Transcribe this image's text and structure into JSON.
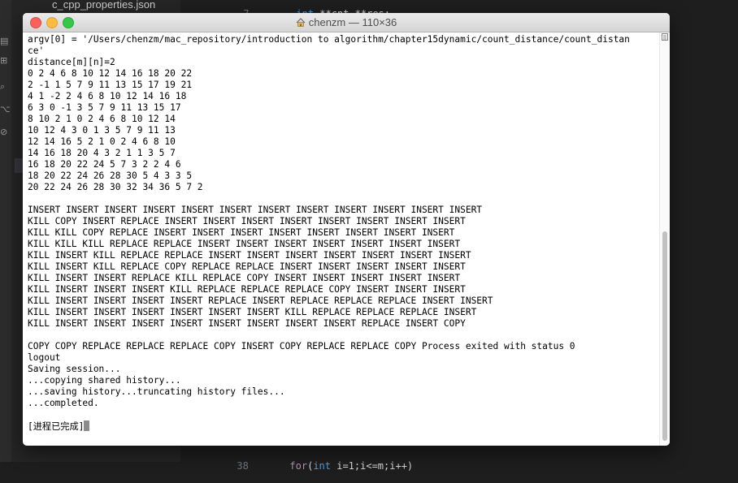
{
  "editor": {
    "sidebar_file": "c_cpp_properties.json",
    "top_code": {
      "line_number": "7",
      "type": "int",
      "rest": " **cnt,**res;"
    },
    "bottom_code": {
      "line_number": "38",
      "keyword": "for",
      "type": "int",
      "rest": " i=1;i<=m;i++)"
    }
  },
  "terminal": {
    "title": "chenzm — 110×36",
    "lines": [
      "argv[0] = '/Users/chenzm/mac_repository/introduction to algorithm/chapter15dynamic/count_distance/count_distan",
      "ce'",
      "distance[m][n]=2",
      "0 2 4 6 8 10 12 14 16 18 20 22",
      "2 -1 1 5 7 9 11 13 15 17 19 21",
      "4 1 -2 2 4 6 8 10 12 14 16 18",
      "6 3 0 -1 3 5 7 9 11 13 15 17",
      "8 10 2 1 0 2 4 6 8 10 12 14",
      "10 12 4 3 0 1 3 5 7 9 11 13",
      "12 14 16 5 2 1 0 2 4 6 8 10",
      "14 16 18 20 4 3 2 1 1 3 5 7",
      "16 18 20 22 24 5 7 3 2 2 4 6",
      "18 20 22 24 26 28 30 5 4 3 3 5",
      "20 22 24 26 28 30 32 34 36 5 7 2",
      "",
      "INSERT INSERT INSERT INSERT INSERT INSERT INSERT INSERT INSERT INSERT INSERT INSERT",
      "KILL COPY INSERT REPLACE INSERT INSERT INSERT INSERT INSERT INSERT INSERT INSERT",
      "KILL KILL COPY REPLACE INSERT INSERT INSERT INSERT INSERT INSERT INSERT INSERT",
      "KILL KILL KILL REPLACE REPLACE INSERT INSERT INSERT INSERT INSERT INSERT INSERT",
      "KILL INSERT KILL REPLACE REPLACE INSERT INSERT INSERT INSERT INSERT INSERT INSERT",
      "KILL INSERT KILL REPLACE COPY REPLACE REPLACE INSERT INSERT INSERT INSERT INSERT",
      "KILL INSERT INSERT REPLACE KILL REPLACE COPY INSERT INSERT INSERT INSERT INSERT",
      "KILL INSERT INSERT INSERT KILL REPLACE REPLACE REPLACE COPY INSERT INSERT INSERT",
      "KILL INSERT INSERT INSERT INSERT REPLACE INSERT REPLACE REPLACE REPLACE INSERT INSERT",
      "KILL INSERT INSERT INSERT INSERT INSERT INSERT KILL REPLACE REPLACE REPLACE INSERT",
      "KILL INSERT INSERT INSERT INSERT INSERT INSERT INSERT INSERT REPLACE INSERT COPY",
      "",
      "COPY COPY REPLACE REPLACE REPLACE COPY INSERT COPY REPLACE REPLACE COPY Process exited with status 0",
      "logout",
      "Saving session...",
      "...copying shared history...",
      "...saving history...truncating history files...",
      "...completed.",
      ""
    ],
    "final_line": "[进程已完成]"
  },
  "colors": {
    "close": "#fc605c",
    "minimize": "#fdbc40",
    "maximize": "#34c84a",
    "keyword": "#c586c0",
    "type": "#569cd6"
  },
  "icons": {
    "title": "home-icon",
    "scroll": "scroll-menu-icon"
  }
}
